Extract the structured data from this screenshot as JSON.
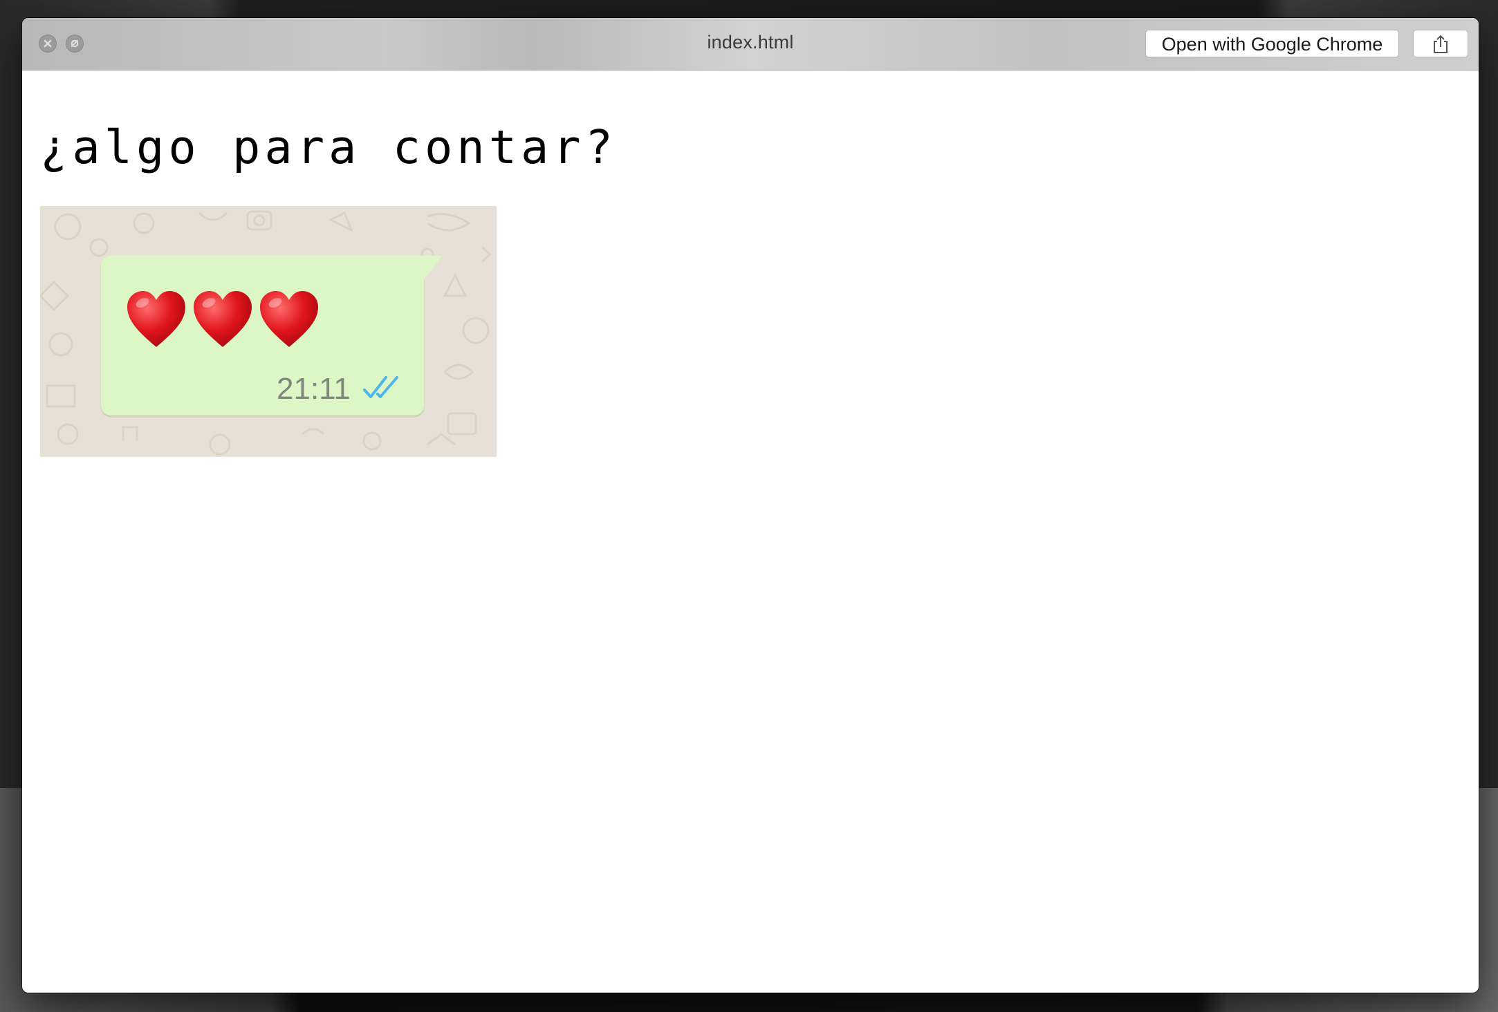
{
  "window": {
    "title": "index.html",
    "open_with_label": "Open with Google Chrome"
  },
  "page": {
    "heading": "¿algo para contar?"
  },
  "message": {
    "emoji_hearts": 3,
    "time": "21:11",
    "status_icon": "double-check-read-icon",
    "bubble_color": "#dcf6c6",
    "background_color": "#e8e0d6",
    "tick_color": "#4fb6ec"
  },
  "icons": {
    "close": "close-icon",
    "minimize": "minimize-icon",
    "share": "share-icon",
    "heart": "red-heart-icon"
  }
}
